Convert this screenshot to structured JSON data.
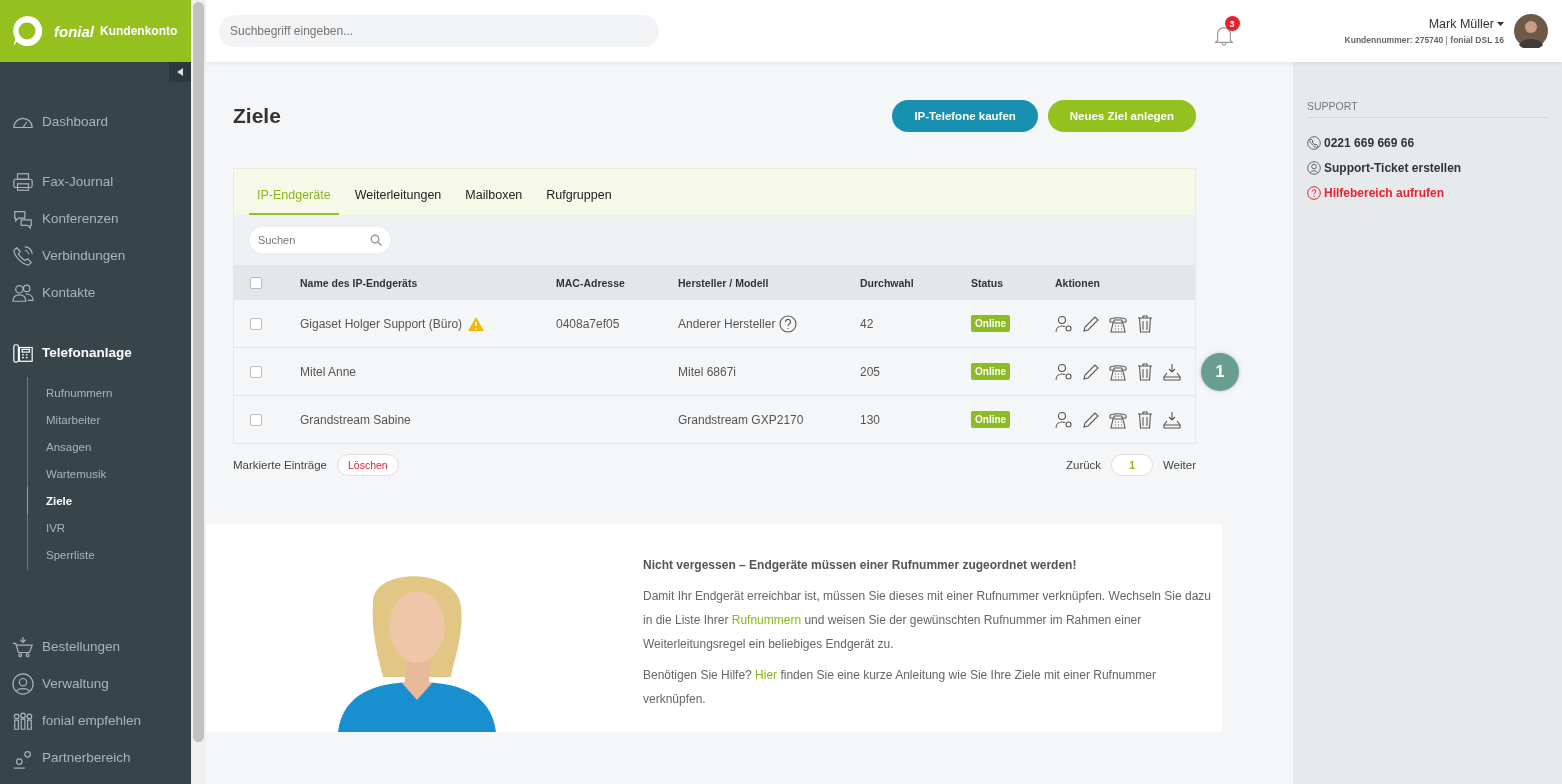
{
  "brand": {
    "name": "fonial",
    "product": "Kundenkonto"
  },
  "sidebar": {
    "sections": [
      {
        "items": [
          {
            "label": "Dashboard",
            "selected": false
          }
        ]
      },
      {
        "items": [
          {
            "label": "Fax-Journal",
            "selected": false
          },
          {
            "label": "Konferenzen",
            "selected": false
          },
          {
            "label": "Verbindungen",
            "selected": false
          },
          {
            "label": "Kontakte",
            "selected": false
          }
        ]
      },
      {
        "items": [
          {
            "label": "Telefonanlage",
            "selected": true,
            "children": [
              {
                "label": "Rufnummern",
                "selected": false
              },
              {
                "label": "Mitarbeiter",
                "selected": false
              },
              {
                "label": "Ansagen",
                "selected": false
              },
              {
                "label": "Wartemusik",
                "selected": false
              },
              {
                "label": "Ziele",
                "selected": true
              },
              {
                "label": "IVR",
                "selected": false
              },
              {
                "label": "Sperrliste",
                "selected": false
              }
            ]
          }
        ]
      },
      {
        "items": [
          {
            "label": "Bestellungen",
            "selected": false
          },
          {
            "label": "Verwaltung",
            "selected": false
          },
          {
            "label": "fonial empfehlen",
            "selected": false
          },
          {
            "label": "Partnerbereich",
            "selected": false
          }
        ]
      }
    ]
  },
  "search": {
    "placeholder": "Suchbegriff eingeben..."
  },
  "notifications": {
    "count": "3"
  },
  "user": {
    "name": "Mark Müller",
    "customer_number": "Kundennummer: 275740",
    "plan": "fonial DSL 16"
  },
  "page": {
    "title": "Ziele",
    "buttons": [
      {
        "label": "IP-Telefone kaufen",
        "kind": "secondary"
      },
      {
        "label": "Neues Ziel anlegen",
        "kind": "primary"
      }
    ]
  },
  "tabs": [
    {
      "label": "IP-Endgeräte",
      "selected": true
    },
    {
      "label": "Weiterleitungen",
      "selected": false
    },
    {
      "label": "Mailboxen",
      "selected": false
    },
    {
      "label": "Rufgruppen",
      "selected": false
    }
  ],
  "table": {
    "search": {
      "placeholder": "Suchen"
    },
    "select_all": false,
    "columns": [
      "Name des IP-Endgeräts",
      "MAC-Adresse",
      "Hersteller / Modell",
      "Durchwahl",
      "Status",
      "Aktionen"
    ],
    "rows": [
      {
        "checked": false,
        "name": "Gigaset Holger Support (Büro)",
        "warning": true,
        "mac": "0408a7ef05",
        "model": "Anderer Hersteller",
        "model_help": true,
        "extension": "42",
        "status": "Online",
        "provisioning": false
      },
      {
        "checked": false,
        "name": "Mitel Anne",
        "warning": false,
        "mac": "",
        "model": "Mitel 6867i",
        "model_help": false,
        "extension": "205",
        "status": "Online",
        "provisioning": true,
        "badge": "1"
      },
      {
        "checked": false,
        "name": "Grandstream Sabine",
        "warning": false,
        "mac": "",
        "model": "Grandstream GXP2170",
        "model_help": false,
        "extension": "130",
        "status": "Online",
        "provisioning": true
      }
    ]
  },
  "footer": {
    "label": "Markierte Einträge",
    "delete": "Löschen",
    "back": "Zurück",
    "page": "1",
    "next": "Weiter"
  },
  "info": {
    "kind": "picture",
    "heading": "Nicht vergessen – Endgeräte müssen einer Rufnummer zugeordnet werden!",
    "paragraphs": [
      {
        "before": "Damit Ihr Endgerät erreichbar ist, müssen Sie dieses mit einer Rufnummer verknüpfen. Wechseln Sie dazu in die Liste Ihrer ",
        "link": "Rufnummern",
        "after": " und weisen Sie der gewünschten Rufnummer im Rahmen einer Weiterleitungsregel ein beliebiges Endgerät zu."
      },
      {
        "before": "Benötigen Sie Hilfe? ",
        "link": "Hier",
        "after": " finden Sie eine kurze Anleitung wie Sie Ihre Ziele mit einer Rufnummer verknüpfen."
      }
    ]
  },
  "support": {
    "title": "SUPPORT",
    "items": [
      {
        "label": "0221 669 669 66",
        "kind": "phone"
      },
      {
        "label": "Support-Ticket erstellen",
        "kind": "ticket"
      },
      {
        "label": "Hilfebereich aufrufen",
        "kind": "help"
      }
    ]
  }
}
